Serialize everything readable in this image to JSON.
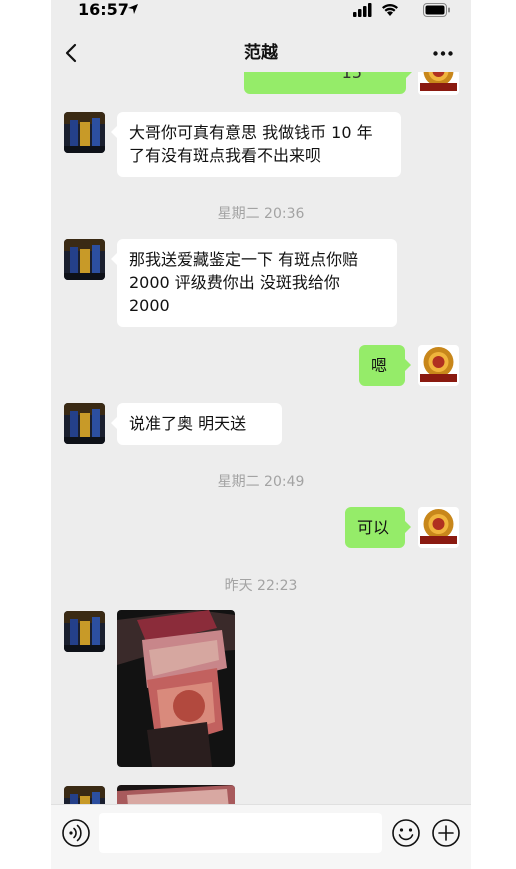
{
  "status": {
    "time": "16:57"
  },
  "nav": {
    "title": "范越"
  },
  "messages": {
    "partial_out_text": "15",
    "m1": {
      "line1": "大哥你可真有意思  我做钱币 10 年",
      "line2": "了有没有斑点我看不出来呗"
    },
    "ts1": "星期二 20:36",
    "m2": {
      "line1": "那我送爱藏鉴定一下  有斑点你赔",
      "line2": "2000 评级费你出  没斑我给你",
      "line3": "2000"
    },
    "m3": "嗯",
    "m4": "说准了奥  明天送",
    "ts2": "星期二 20:49",
    "m5": "可以",
    "ts3": "昨天 22:23"
  },
  "icons": {
    "back": "chevron-left-icon",
    "more": "more-dots-icon",
    "voice": "voice-icon",
    "emoji": "emoji-icon",
    "add": "add-icon"
  },
  "colors": {
    "chat_bg": "#ededed",
    "bubble_out": "#95ec69",
    "bubble_in": "#ffffff",
    "timestamp": "#a3a3a3"
  }
}
